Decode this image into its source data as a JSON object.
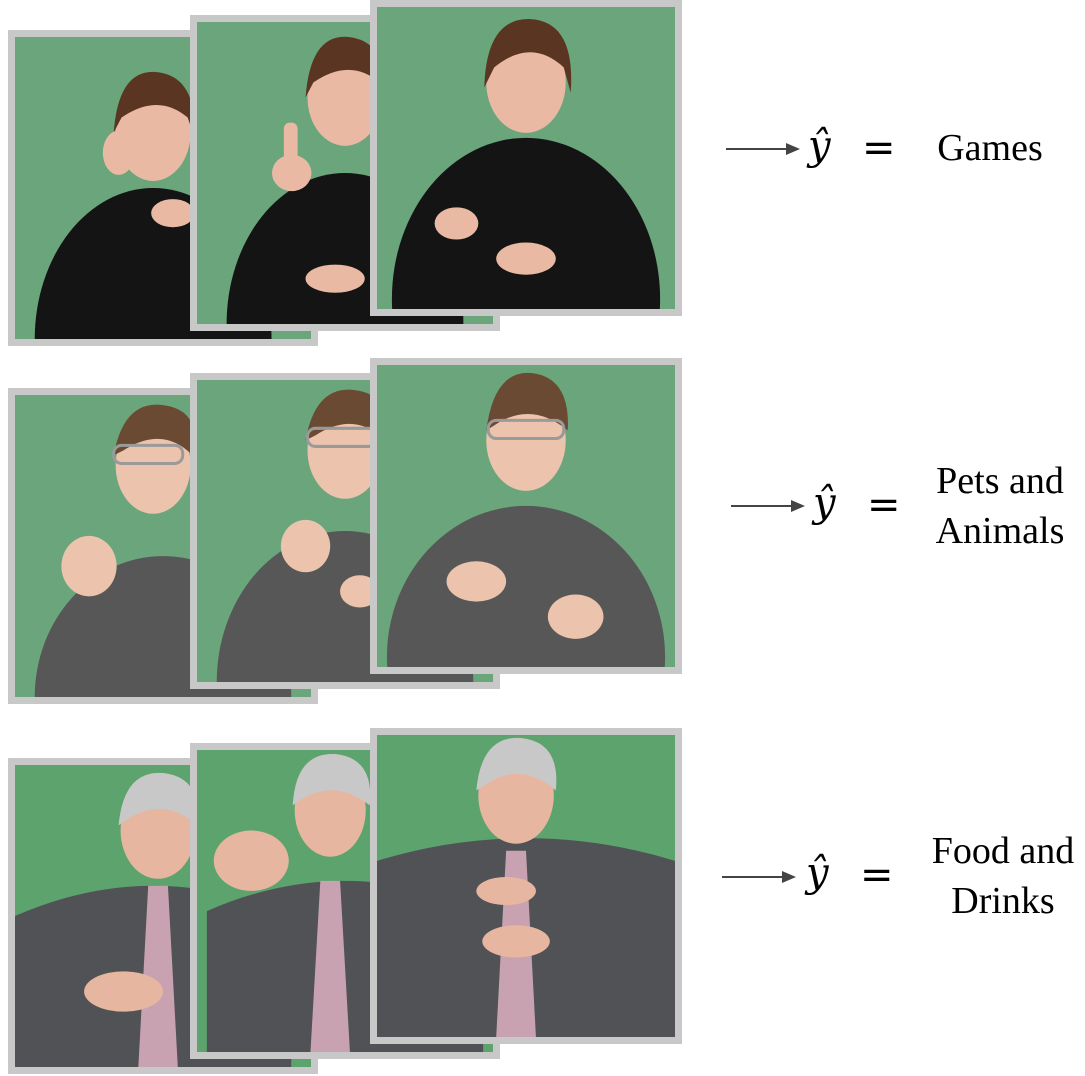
{
  "colors": {
    "background": "#ffffff",
    "frame_border": "#c8c8c8",
    "green_screen": "#6aa57c",
    "arrow": "#444444",
    "text": "#000000"
  },
  "rows": [
    {
      "signer": "woman-short-hair",
      "shirt_color": "#141414",
      "prediction_symbol": "ŷ",
      "equals": "=",
      "label_lines": [
        "Games"
      ]
    },
    {
      "signer": "woman-glasses",
      "shirt_color": "#575757",
      "prediction_symbol": "ŷ",
      "equals": "=",
      "label_lines": [
        "Pets and",
        "Animals"
      ]
    },
    {
      "signer": "man-glasses-tie",
      "shirt_color": "#505256",
      "prediction_symbol": "ŷ",
      "equals": "=",
      "label_lines": [
        "Food and",
        "Drinks"
      ]
    }
  ]
}
